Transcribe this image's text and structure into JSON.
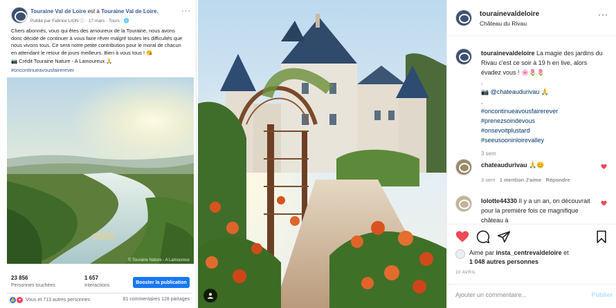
{
  "facebook": {
    "page_name": "Touraine Val de Loire",
    "at_text": "est à",
    "location": "Touraine Val de Loire.",
    "published_by": "Publié par Fabrice LION",
    "date": "17 mars",
    "place": "Tours",
    "more": "···",
    "post_text": "Chers abonnés, vous qui êtes des amoureux de la Touraine, nous avons\ndonc décidé de continuer à vous faire rêver malgré toutes les difficultés que\nnous vivons tous. Ce sera notre petite contribution pour le moral de chacun\nen attendant le retour de jours meilleurs. Bien à vous tous ! 😘",
    "credit": "📷 Crédit Touraine Nature - A Lamoureux 🙏",
    "hashtag": "#oncontinueavousfairerever",
    "photo_watermark": "© Touraine Nature - A Lamoureux",
    "stats": [
      {
        "value": "23 856",
        "label": "Personnes touchées"
      },
      {
        "value": "1 657",
        "label": "Interactions"
      }
    ],
    "boost_label": "Booster la publication",
    "reactions_text": "Vous et 713 autres personnes",
    "counts_text": "81 commentaires  128 partages"
  },
  "instagram": {
    "username": "tourainevaldeloire",
    "location": "Château du Rivau",
    "more": "···",
    "caption": {
      "user": "tourainevaldeloire",
      "text": "La magie des jardins du Rivau c'est ce soir à 19 h en live, alors évadez vous ! 🌸🌷🌷",
      "dot1": ".",
      "mention": "📷 @chateaudurivau 🙏",
      "dot2": ".",
      "tags": [
        "#oncontinueavousfairerever",
        "#prenezsoindevous",
        "#onsevoitplustard",
        "#seeusooninloirevalley"
      ],
      "time": "3 sem"
    },
    "comments": [
      {
        "user": "chateaudurivau",
        "text": "🙏😊",
        "time": "3 sem",
        "likes": "1 mention J'aime",
        "reply": "Répondre"
      },
      {
        "user": "lolotte44330",
        "text": "Il y a un an, on découvrait pour la première fois ce magnifique château à"
      }
    ],
    "liked_by": "Aimé par",
    "liked_user": "insta_centrevaldeloire",
    "liked_and": "et",
    "liked_others": "1 048 autres personnes",
    "date": "10 AVRIL",
    "comment_placeholder": "Ajouter un commentaire...",
    "post_label": "Publier"
  },
  "colors": {
    "fb_blue": "#385898",
    "boost_blue": "#1877f2",
    "ig_heart": "#ed4956",
    "ig_link": "#00376b"
  }
}
